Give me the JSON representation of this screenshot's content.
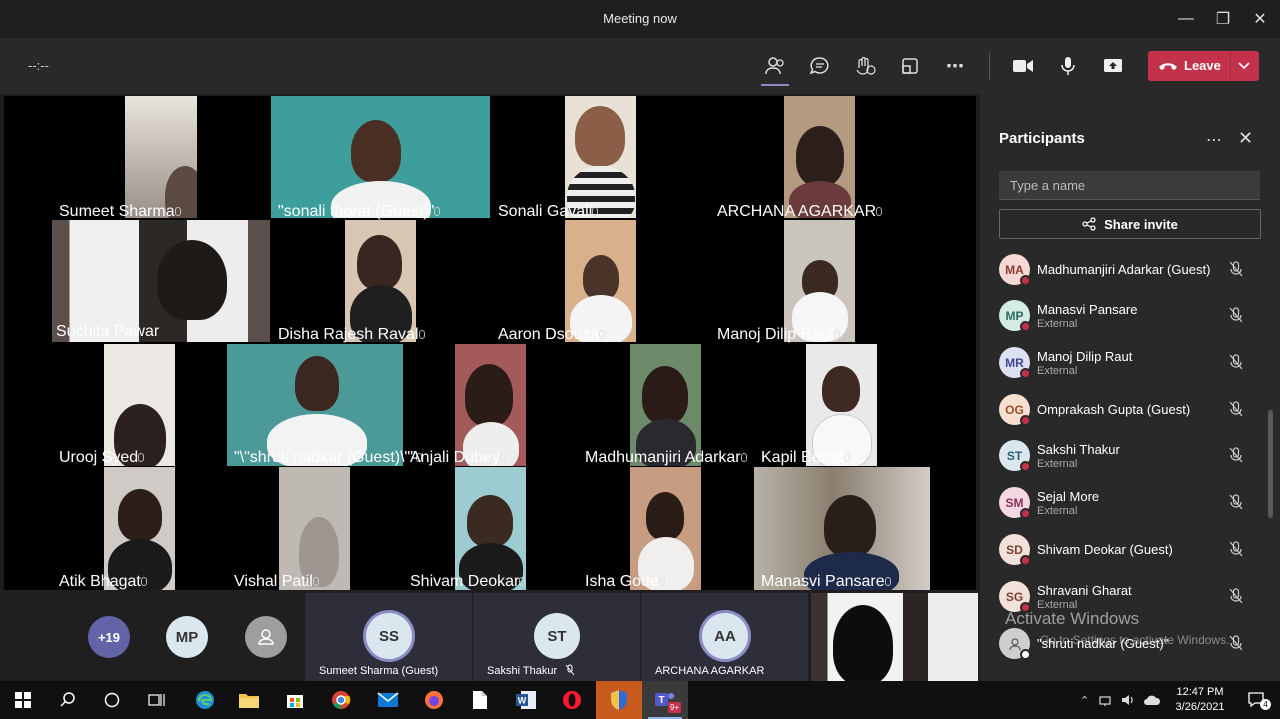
{
  "window": {
    "title": "Meeting now"
  },
  "toolbar": {
    "timer": "--:--",
    "leave_label": "Leave"
  },
  "tiles": [
    {
      "name": "Sumeet Sharma"
    },
    {
      "name": "\"sonali thorat (Guest)\""
    },
    {
      "name": "Sonali Gavali"
    },
    {
      "name": "ARCHANA AGARKAR"
    },
    {
      "name": "Suchita Pawar"
    },
    {
      "name": "Disha Rajesh Raval"
    },
    {
      "name": "Aaron Dsouza"
    },
    {
      "name": "Manoj Dilip Raut"
    },
    {
      "name": "Urooj Syed"
    },
    {
      "name": "\"\\\"shruti nadkar (Guest)\\\"\""
    },
    {
      "name": "Anjali Dubey"
    },
    {
      "name": "Madhumanjiri Adarkar"
    },
    {
      "name": "Kapil Berad"
    },
    {
      "name": "Atik Bhagat"
    },
    {
      "name": "Vishal Patil"
    },
    {
      "name": "Shivam Deokar"
    },
    {
      "name": "Isha Gode"
    },
    {
      "name": "Manasvi Pansare"
    }
  ],
  "strip": {
    "overflow": "+19",
    "mp": "MP",
    "participants": [
      {
        "initials": "SS",
        "name": "Sumeet Sharma (Guest)"
      },
      {
        "initials": "ST",
        "name": "Sakshi Thakur"
      },
      {
        "initials": "AA",
        "name": "ARCHANA AGARKAR"
      }
    ]
  },
  "panel": {
    "title": "Participants",
    "search_placeholder": "Type a name",
    "share_label": "Share invite",
    "people": [
      {
        "initials": "MA",
        "name": "Madhumanjiri Adarkar (Guest)",
        "sub": ""
      },
      {
        "initials": "MP",
        "name": "Manasvi Pansare",
        "sub": "External"
      },
      {
        "initials": "MR",
        "name": "Manoj Dilip Raut",
        "sub": "External"
      },
      {
        "initials": "OG",
        "name": "Omprakash Gupta (Guest)",
        "sub": ""
      },
      {
        "initials": "ST",
        "name": "Sakshi Thakur",
        "sub": "External"
      },
      {
        "initials": "SM",
        "name": "Sejal More",
        "sub": "External"
      },
      {
        "initials": "SD",
        "name": "Shivam Deokar (Guest)",
        "sub": ""
      },
      {
        "initials": "SG",
        "name": "Shravani Gharat",
        "sub": "External"
      },
      {
        "initials": "",
        "name": "\"shruti nadkar (Guest)\"",
        "sub": ""
      }
    ]
  },
  "watermark": {
    "line1": "Activate Windows",
    "line2": "Go to Settings to activate Windows."
  },
  "taskbar": {
    "time": "12:47 PM",
    "date": "3/26/2021",
    "teams_badge": "9+",
    "notif_count": "4"
  }
}
